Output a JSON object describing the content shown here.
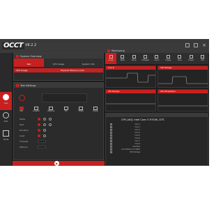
{
  "app": {
    "logo": "OCCT",
    "version": "V8.2.2"
  },
  "sidebar": [
    {
      "label": "Test",
      "icon": "flame-icon"
    },
    {
      "label": "Info",
      "icon": "info-icon"
    },
    {
      "label": "Tools",
      "icon": "wrench-icon"
    }
  ],
  "system_panel": {
    "title": "System Overview",
    "tabs": [
      "Test",
      "CPU Usage",
      "System Info"
    ],
    "metrics": [
      "CPU Usage",
      "Physical Memory Load"
    ]
  },
  "test_panel": {
    "title": "Test Settings",
    "tools": [
      "CPU",
      "Linpack",
      "Memory",
      "3D",
      "VRAM",
      "Power"
    ],
    "rows": [
      {
        "label": "Mode"
      },
      {
        "label": "Test"
      },
      {
        "label": "Duration"
      },
      {
        "label": "Load"
      },
      {
        "label": "Threads"
      },
      {
        "label": "Options"
      }
    ]
  },
  "monitor_panel": {
    "title": "Monitoring",
    "tabs": [
      "Graph",
      "Table",
      "Temp",
      "Voltages",
      "Clock",
      "Usage",
      "Fans",
      "Power",
      "CPU"
    ],
    "graphs": [
      "Core #",
      "CPU Package",
      "CPU Package",
      "CPU Temperature"
    ],
    "device": "CPU [#0]: Intel Core i7-9700K, DTS",
    "rows": [
      "Core 1",
      "Core 2",
      "Core 3",
      "Core 4",
      "Core 5",
      "Core 6",
      "Core 7",
      "Core 8",
      "Core Max",
      "Core Distance to TjMAX",
      "CPU Package"
    ]
  }
}
